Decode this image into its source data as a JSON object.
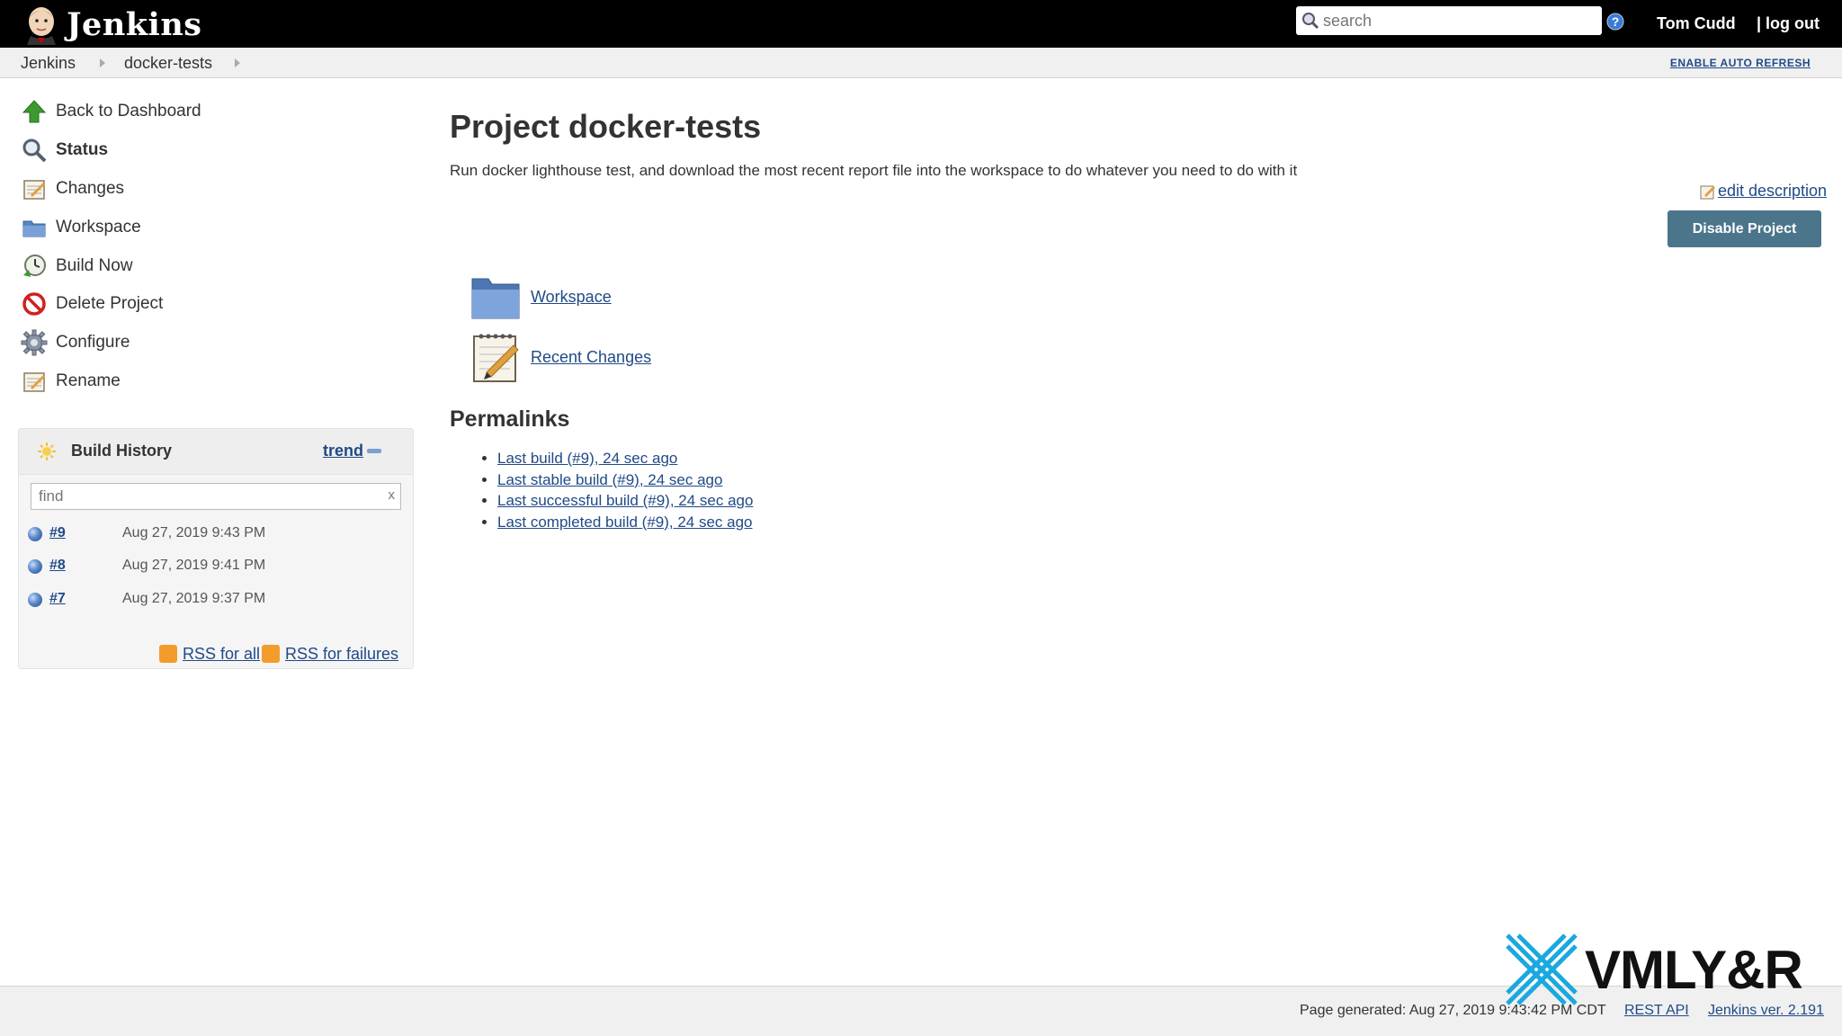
{
  "header": {
    "logo_text": "Jenkins",
    "search_placeholder": "search",
    "user_name": "Tom Cudd",
    "logout_label": "| log out"
  },
  "breadcrumb": {
    "items": [
      "Jenkins",
      "docker-tests"
    ],
    "auto_refresh": "ENABLE AUTO REFRESH"
  },
  "sidebar": {
    "tasks": [
      {
        "label": "Back to Dashboard",
        "icon": "up-arrow-icon"
      },
      {
        "label": "Status",
        "icon": "search-icon"
      },
      {
        "label": "Changes",
        "icon": "notepad-icon"
      },
      {
        "label": "Workspace",
        "icon": "folder-icon"
      },
      {
        "label": "Build Now",
        "icon": "clock-icon"
      },
      {
        "label": "Delete Project",
        "icon": "no-entry-icon"
      },
      {
        "label": "Configure",
        "icon": "gear-icon"
      },
      {
        "label": "Rename",
        "icon": "notepad-icon"
      }
    ],
    "active_task": "Status"
  },
  "build_history": {
    "title": "Build History",
    "trend_label": "trend",
    "find_placeholder": "find",
    "clear_label": "x",
    "builds": [
      {
        "number": "#9",
        "date": "Aug 27, 2019 9:43 PM"
      },
      {
        "number": "#8",
        "date": "Aug 27, 2019 9:41 PM"
      },
      {
        "number": "#7",
        "date": "Aug 27, 2019 9:37 PM"
      }
    ],
    "rss_all": "RSS for all",
    "rss_failures": "RSS for failures"
  },
  "main": {
    "title": "Project docker-tests",
    "description": "Run docker lighthouse test, and download the most recent report file into the workspace to do whatever you need to do with it",
    "edit_description": "edit description",
    "disable_button": "Disable Project",
    "links": [
      {
        "label": "Workspace",
        "icon": "folder-icon"
      },
      {
        "label": "Recent Changes",
        "icon": "notepad-icon"
      }
    ],
    "permalinks_title": "Permalinks",
    "permalinks": [
      "Last build (#9), 24 sec ago",
      "Last stable build (#9), 24 sec ago",
      "Last successful build (#9), 24 sec ago",
      "Last completed build (#9), 24 sec ago"
    ]
  },
  "footer": {
    "page_generated": "Page generated: Aug 27, 2019 9:43:42 PM CDT",
    "rest_api": "REST API",
    "jenkins_version": "Jenkins ver. 2.191"
  },
  "watermark": {
    "text": "VMLY&R"
  },
  "colors": {
    "header_bg": "#000000",
    "link": "#204a87",
    "button_bg": "#4b758b",
    "build_ball": "#5a88c8",
    "rss": "#f39c2b"
  }
}
